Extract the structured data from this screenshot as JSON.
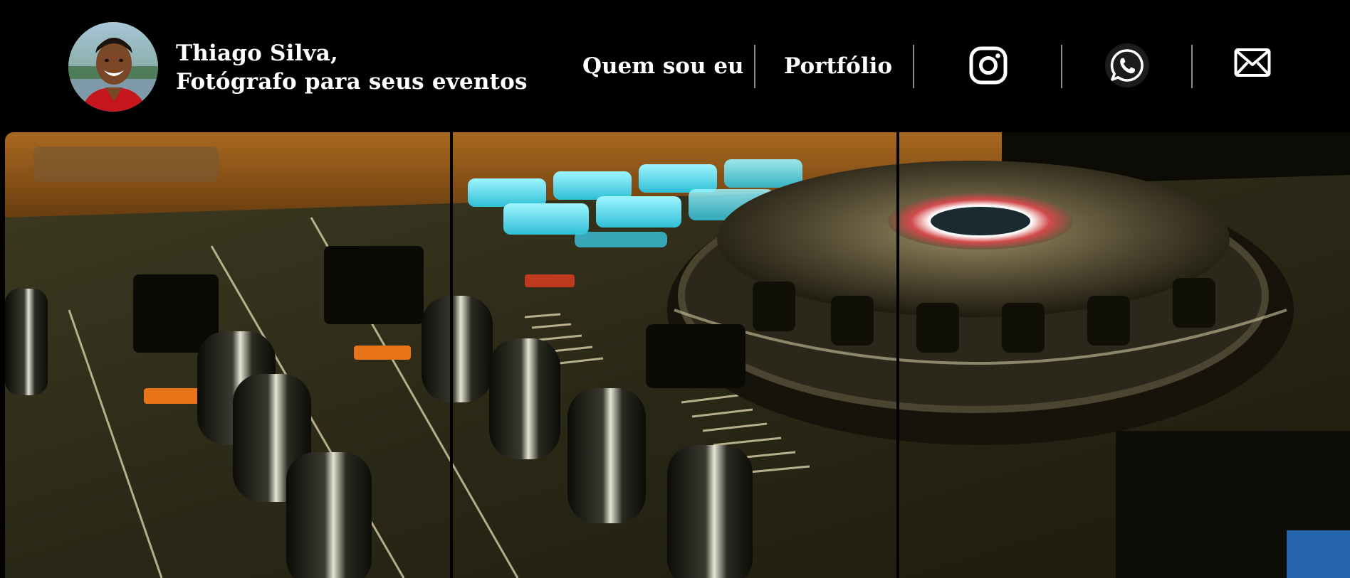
{
  "header": {
    "name_line": "Thiago Silva,",
    "tagline_line": "Fotógrafo para seus eventos"
  },
  "nav": {
    "items": [
      {
        "label": "Quem sou eu"
      },
      {
        "label": "Portfólio"
      }
    ],
    "social": [
      {
        "icon": "instagram-icon"
      },
      {
        "icon": "whatsapp-icon"
      },
      {
        "icon": "mail-icon"
      }
    ]
  },
  "theme": {
    "background": "#000000",
    "text": "#ffffff",
    "divider": "#8a8a8a"
  }
}
